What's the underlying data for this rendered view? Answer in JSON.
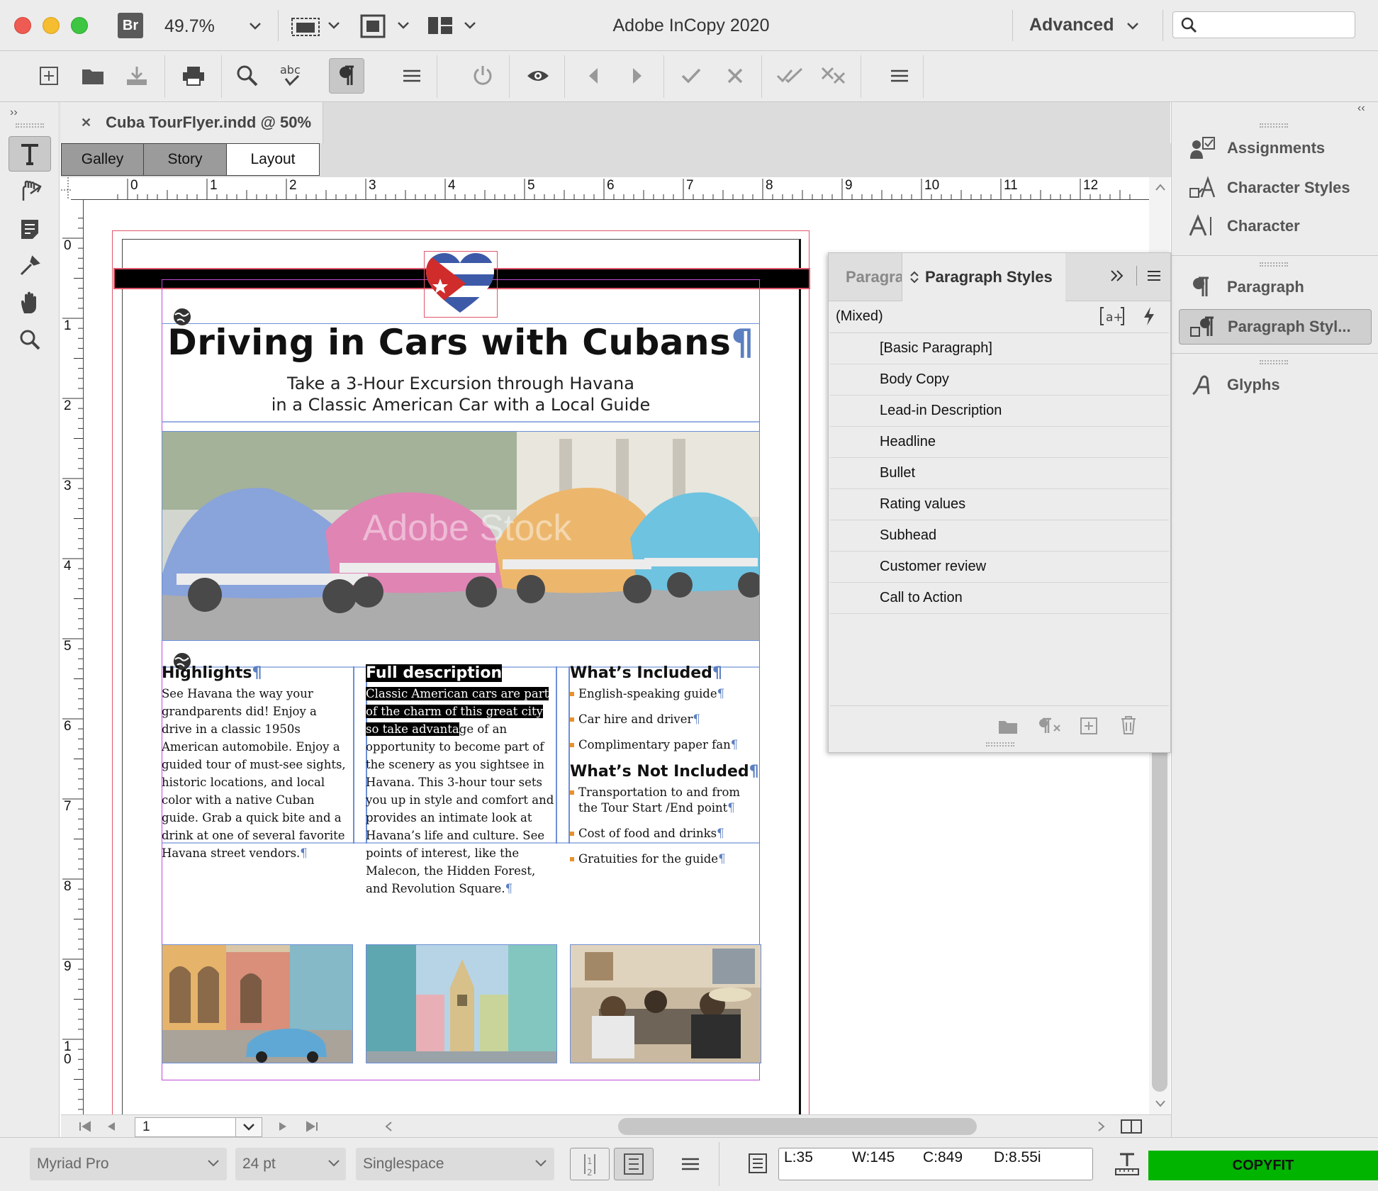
{
  "app": {
    "title": "Adobe InCopy 2020",
    "bridge_badge": "Br",
    "zoom": "49.7%",
    "workspace": "Advanced",
    "search_placeholder": ""
  },
  "document": {
    "tab_title": "Cuba TourFlyer.indd @ 50%",
    "close_glyph": "✕",
    "view_tabs": [
      "Galley",
      "Story",
      "Layout"
    ],
    "ruler_top": [
      "0",
      "1",
      "2",
      "3",
      "4",
      "5",
      "6",
      "7",
      "8",
      "9",
      "10",
      "11",
      "12"
    ],
    "ruler_left": [
      "0",
      "1",
      "2",
      "3",
      "4",
      "5",
      "6",
      "7",
      "8",
      "9",
      "1\n0"
    ],
    "page_number": "1"
  },
  "flyer": {
    "headline": "Driving in Cars with Cubans",
    "subhead_line1": "Take a 3-Hour Excursion through Havana",
    "subhead_line2": "in a Classic American Car with a Local Guide",
    "watermark": "Adobe Stock",
    "highlights_title": "Highlights",
    "highlights_body": "See Havana the way your grandparents did! Enjoy a drive in a classic 1950s American automobile. Enjoy a guided tour of must-see sights, historic locations, and local color with a native Cuban guide. Grab a quick bite and a drink at one of several favorite Havana street vendors.",
    "fulldesc_title": "Full description",
    "fulldesc_selected": "Classic American cars are part of the charm of this great city so take advanta",
    "fulldesc_rest": "ge of an opportunity to become part of the scenery as you sightsee in Havana. This 3-hour tour sets you up in style and comfort and provides an intimate look at Havana’s life and culture. See points of interest, like the Malecon, the Hidden Forest, and Revolution Square.",
    "included_title": "What’s Included",
    "included_items": [
      "English-speaking guide",
      "Car hire and driver",
      "Complimentary paper fan"
    ],
    "not_included_title": "What’s Not Included",
    "not_included_items": [
      "Transportation to and from the Tour Start /End point",
      "Cost of food and drinks",
      "Gratuities for the guide"
    ],
    "pilcrow": "¶"
  },
  "paragraph_styles_panel": {
    "tab_inactive": "Paragra",
    "tab_active": "Paragraph Styles",
    "current": "(Mixed)",
    "styles": [
      "[Basic Paragraph]",
      "Body Copy",
      "Lead-in Description",
      "Headline",
      "Bullet",
      "Rating values",
      "Subhead",
      "Customer review",
      "Call to Action"
    ]
  },
  "dock": {
    "items": [
      "Assignments",
      "Character Styles",
      "Character",
      "Paragraph",
      "Paragraph Styl...",
      "Glyphs"
    ]
  },
  "statusbar": {
    "font": "Myriad Pro",
    "size": "24 pt",
    "spacing": "Singlespace",
    "lines": "L:35",
    "words": "W:145",
    "chars": "C:849",
    "depth": "D:8.55i",
    "copyfit": "COPYFIT",
    "copyfit_color": "#00b400"
  },
  "colors": {
    "accent_orange": "#e8912d",
    "frame_blue": "#6d8fd6",
    "margin_magenta": "#c04bd6",
    "bleed_red": "#e0566b",
    "pilcrow_blue": "#5b7fc1"
  }
}
